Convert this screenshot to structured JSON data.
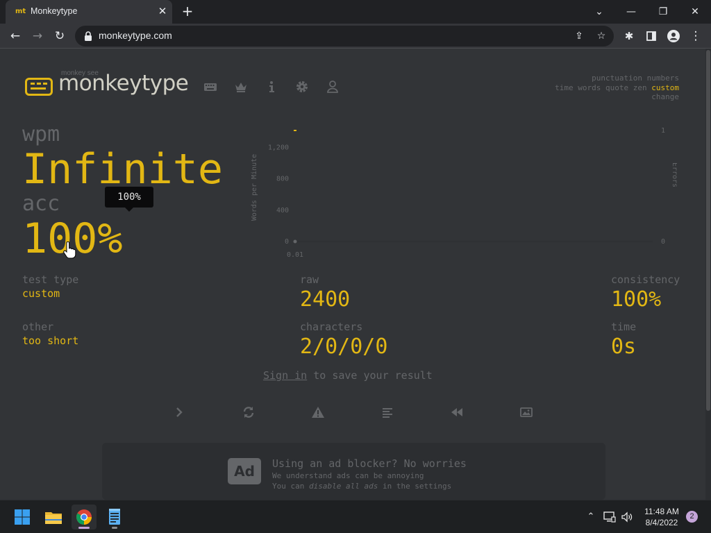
{
  "browser": {
    "tab_favicon": "mt",
    "tab_title": "Monkeytype",
    "tab_close": "✕",
    "new_tab": "+",
    "url": "monkeytype.com",
    "window_controls": {
      "dropdown": "⌄",
      "minimize": "—",
      "restore": "❐",
      "close": "✕"
    }
  },
  "header": {
    "logo_sub": "monkey see",
    "logo_text": "monkeytype",
    "nav_icons": [
      "keyboard-icon",
      "crown-icon",
      "info-icon",
      "gear-icon",
      "user-icon"
    ]
  },
  "config": {
    "line1": [
      "punctuation",
      "numbers"
    ],
    "line2_modes": [
      "time",
      "words",
      "quote",
      "zen"
    ],
    "line2_active": "custom",
    "line3": "change"
  },
  "results": {
    "wpm_label": "wpm",
    "wpm_value": "Infinite",
    "acc_label": "acc",
    "acc_value": "100%",
    "tooltip": "100%",
    "test_type_label": "test type",
    "test_type_value": "custom",
    "other_label": "other",
    "other_value": "too short",
    "raw_label": "raw",
    "raw_value": "2400",
    "characters_label": "characters",
    "characters_value": "2/0/0/0",
    "consistency_label": "consistency",
    "consistency_value": "100%",
    "time_label": "time",
    "time_value": "0s"
  },
  "chart_data": {
    "type": "line",
    "ylabel": "Words per Minute",
    "y2label": "Errors",
    "yticks": [
      "1,200",
      "800",
      "400",
      "0"
    ],
    "y2ticks": [
      "1",
      "0"
    ],
    "xticks": [
      "0.01"
    ],
    "series": [
      {
        "values": [
          [
            0.01,
            0
          ]
        ]
      }
    ],
    "errors": [
      [
        0.01,
        1
      ]
    ]
  },
  "signin": {
    "link": "Sign in",
    "text": " to save your result"
  },
  "actions": [
    "next-test-icon",
    "restart-icon",
    "report-icon",
    "words-history-icon",
    "replay-icon",
    "screenshot-icon"
  ],
  "ad": {
    "badge": "Ad",
    "title": "Using an ad blocker? No worries",
    "line1": "We understand ads can be annoying",
    "line2_pre": "You can ",
    "line2_em": "disable all ads",
    "line2_post": " in the settings"
  },
  "taskbar": {
    "time": "11:48 AM",
    "date": "8/4/2022",
    "notifications": "2"
  },
  "colors": {
    "background": "#323437",
    "main": "#e2b714",
    "sub": "#646669",
    "text": "#d1d0c5"
  }
}
